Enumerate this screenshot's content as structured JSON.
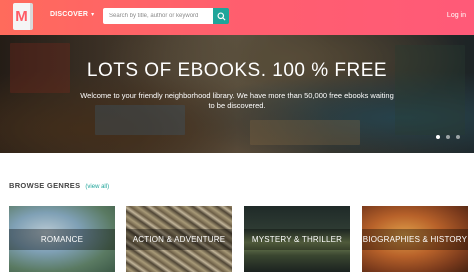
{
  "header": {
    "logo_letter": "M",
    "discover_label": "DISCOVER",
    "search_placeholder": "Search by title, author or keyword",
    "login_label": "Log in"
  },
  "hero": {
    "title": "LOTS OF EBOOKS. 100 % FREE",
    "subtitle": "Welcome to your friendly neighborhood library. We have more than 50,000 free ebooks waiting to be discovered.",
    "slides_total": 3,
    "active_slide": 1
  },
  "genres": {
    "title": "BROWSE GENRES",
    "view_all": "(view all)",
    "items": [
      {
        "label": "ROMANCE",
        "color": "#6f8fa8"
      },
      {
        "label": "ACTION & ADVENTURE",
        "color": "#8b7b5a"
      },
      {
        "label": "MYSTERY & THRILLER",
        "color": "#3d4a3a"
      },
      {
        "label": "BIOGRAPHIES & HISTORY",
        "color": "#a8622a"
      }
    ]
  },
  "colors": {
    "header_start": "#ff6b5c",
    "header_end": "#ff5a78",
    "accent": "#1fa59a"
  }
}
